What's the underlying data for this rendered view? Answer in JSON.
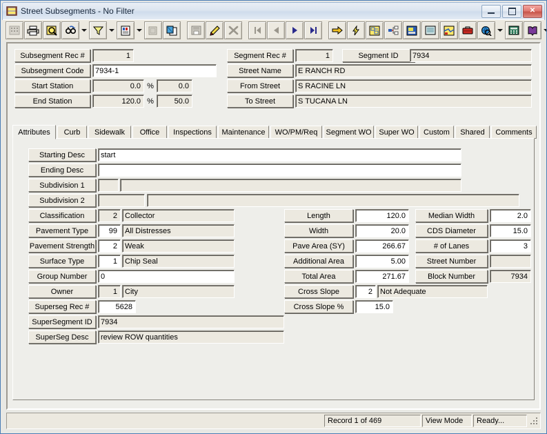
{
  "window": {
    "title": "Street Subsegments - No Filter",
    "icon": "street-segment-icon",
    "controls": {
      "minimize": "Minimize",
      "restore": "Restore",
      "close": "Close"
    }
  },
  "toolbar": {
    "buttons": [
      {
        "name": "grid-view-icon",
        "label": "Grid View"
      },
      {
        "name": "print-icon",
        "label": "Print"
      },
      {
        "name": "print-preview-icon",
        "label": "Print Preview"
      },
      {
        "name": "find-icon",
        "label": "Find"
      },
      {
        "name": "find-dropdown-icon",
        "label": "Find Options"
      },
      {
        "name": "filter-icon",
        "label": "Filter"
      },
      {
        "name": "filter-dropdown-icon",
        "label": "Filter Options"
      },
      {
        "name": "report-icon",
        "label": "Report"
      },
      {
        "name": "report-dropdown-icon",
        "label": "Report Options"
      },
      {
        "name": "export-icon",
        "label": "Export"
      },
      {
        "name": "copy-record-icon",
        "label": "Copy Record"
      },
      {
        "name": "save-icon",
        "label": "Save"
      },
      {
        "name": "edit-icon",
        "label": "Edit"
      },
      {
        "name": "delete-icon",
        "label": "Delete"
      },
      {
        "name": "first-record-icon",
        "label": "First Record"
      },
      {
        "name": "previous-record-icon",
        "label": "Previous Record"
      },
      {
        "name": "next-record-icon",
        "label": "Next Record"
      },
      {
        "name": "last-record-icon",
        "label": "Last Record"
      },
      {
        "name": "goto-icon",
        "label": "Go To"
      },
      {
        "name": "quick-action-icon",
        "label": "Quick Action"
      },
      {
        "name": "layout-icon",
        "label": "Layout"
      },
      {
        "name": "hierarchy-icon",
        "label": "Hierarchy"
      },
      {
        "name": "image-icon",
        "label": "Image"
      },
      {
        "name": "phone-icon",
        "label": "Contacts"
      },
      {
        "name": "map-icon",
        "label": "Map"
      },
      {
        "name": "toolbox-icon",
        "label": "Toolbox"
      },
      {
        "name": "globe-icon",
        "label": "Web"
      },
      {
        "name": "globe-dropdown-icon",
        "label": "Web Options"
      },
      {
        "name": "calculator-icon",
        "label": "Calculator"
      },
      {
        "name": "help-book-icon",
        "label": "Help"
      },
      {
        "name": "help-dropdown-icon",
        "label": "Help Options"
      },
      {
        "name": "exit-icon",
        "label": "Exit"
      }
    ]
  },
  "header": {
    "left": [
      {
        "label": "Subsegment Rec #",
        "value": "1",
        "type": "number-readonly"
      },
      {
        "label": "Subsegment Code",
        "value": "7934-1",
        "type": "text-editable"
      },
      {
        "label": "Start Station",
        "value": "0.0",
        "pct_symbol": "%",
        "pct_value": "0.0",
        "type": "station"
      },
      {
        "label": "End Station",
        "value": "120.0",
        "pct_symbol": "%",
        "pct_value": "50.0",
        "type": "station"
      }
    ],
    "right": [
      {
        "label": "Segment Rec #",
        "value": "1"
      },
      {
        "label": "Street Name",
        "value": "E RANCH RD"
      },
      {
        "label": "From Street",
        "value": "S RACINE LN"
      },
      {
        "label": "To Street",
        "value": "S TUCANA LN"
      }
    ],
    "segment_id": {
      "label": "Segment ID",
      "value": "7934"
    }
  },
  "tabs": [
    {
      "label": "Attributes",
      "active": true
    },
    {
      "label": "Curb",
      "active": false
    },
    {
      "label": "Sidewalk",
      "active": false
    },
    {
      "label": "Office",
      "active": false
    },
    {
      "label": "Inspections",
      "active": false
    },
    {
      "label": "Maintenance",
      "active": false
    },
    {
      "label": "WO/PM/Req",
      "active": false
    },
    {
      "label": "Segment WO",
      "active": false
    },
    {
      "label": "Super WO",
      "active": false
    },
    {
      "label": "Custom",
      "active": false
    },
    {
      "label": "Shared",
      "active": false
    },
    {
      "label": "Comments",
      "active": false
    }
  ],
  "attributes": {
    "left_column": [
      {
        "label": "Starting Desc",
        "value": "start",
        "white": true
      },
      {
        "label": "Ending Desc",
        "value": "",
        "white": true
      },
      {
        "label": "Subdivision 1",
        "code": "",
        "value": ""
      },
      {
        "label": "Subdivision 2",
        "code": "",
        "value": ""
      },
      {
        "label": "Classification",
        "code": "2",
        "value": "Collector"
      },
      {
        "label": "Pavement Type",
        "code": "99",
        "value": "All Distresses"
      },
      {
        "label": "Pavement Strength",
        "code": "2",
        "value": "Weak"
      },
      {
        "label": "Surface Type",
        "code": "1",
        "value": "Chip Seal"
      },
      {
        "label": "Group Number",
        "value": "0",
        "white": true
      },
      {
        "label": "Owner",
        "code": "1",
        "value": "City"
      },
      {
        "label": "Superseg Rec #",
        "value": "5628",
        "white": true
      },
      {
        "label": "SuperSegment ID",
        "value": "7934"
      },
      {
        "label": "SuperSeg Desc",
        "value": "review ROW quantities"
      }
    ],
    "middle_column": [
      {
        "label": "Length",
        "value": "120.0"
      },
      {
        "label": "Width",
        "value": "20.0"
      },
      {
        "label": "Pave Area (SY)",
        "value": "266.67"
      },
      {
        "label": "Additional Area",
        "value": "5.00"
      },
      {
        "label": "Total Area",
        "value": "271.67"
      }
    ],
    "cross_slope": {
      "label": "Cross Slope",
      "code": "2",
      "value": "Not Adequate"
    },
    "cross_slope_pct": {
      "label": "Cross Slope %",
      "value": "15.0"
    },
    "right_column": [
      {
        "label": "Median Width",
        "value": "2.0",
        "white": true
      },
      {
        "label": "CDS Diameter",
        "value": "15.0",
        "white": true
      },
      {
        "label": "# of Lanes",
        "value": "3",
        "white": true
      },
      {
        "label": "Street Number",
        "value": "",
        "white": false
      },
      {
        "label": "Block Number",
        "value": "7934",
        "white": false
      }
    ]
  },
  "statusbar": {
    "record": "Record 1 of 469",
    "mode": "View Mode",
    "state": "Ready...",
    "grip": "resize-grip"
  },
  "colors": {
    "face": "#ece9e0",
    "panel": "#eeeeea",
    "shadow": "#85827b",
    "dark_shadow": "#5f5d57",
    "highlight": "#ffffff",
    "title_text": "#18283c",
    "close_button": "#c85449",
    "desktop": "#6a9fd8"
  }
}
